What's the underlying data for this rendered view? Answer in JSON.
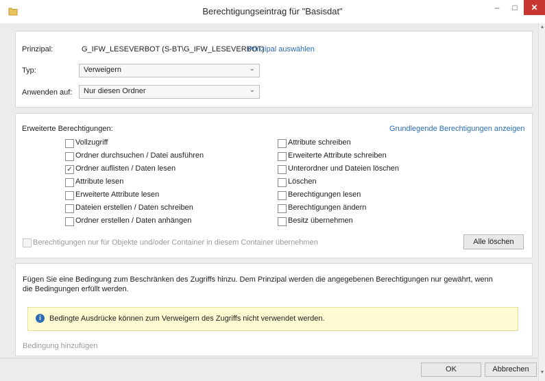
{
  "window": {
    "title": "Berechtigungseintrag für \"Basisdat\"",
    "minimize_glyph": "–",
    "maximize_glyph": "□",
    "close_glyph": "✕"
  },
  "principal": {
    "label": "Prinzipal:",
    "value": "G_IFW_LESEVERBOT (S-BT\\G_IFW_LESEVERBOT)",
    "select_link": "Prinzipal auswählen"
  },
  "type": {
    "label": "Typ:",
    "value": "Verweigern"
  },
  "apply_to": {
    "label": "Anwenden auf:",
    "value": "Nur diesen Ordner"
  },
  "advanced": {
    "header": "Erweiterte Berechtigungen:",
    "basic_link": "Grundlegende Berechtigungen anzeigen",
    "left": [
      {
        "label": "Vollzugriff",
        "checked": false
      },
      {
        "label": "Ordner durchsuchen / Datei ausführen",
        "checked": false
      },
      {
        "label": "Ordner auflisten / Daten lesen",
        "checked": true
      },
      {
        "label": "Attribute lesen",
        "checked": false
      },
      {
        "label": "Erweiterte Attribute lesen",
        "checked": false
      },
      {
        "label": "Dateien erstellen / Daten schreiben",
        "checked": false
      },
      {
        "label": "Ordner erstellen / Daten anhängen",
        "checked": false
      }
    ],
    "right": [
      {
        "label": "Attribute schreiben",
        "checked": false
      },
      {
        "label": "Erweiterte Attribute schreiben",
        "checked": false
      },
      {
        "label": "Unterordner und Dateien löschen",
        "checked": false
      },
      {
        "label": "Löschen",
        "checked": false
      },
      {
        "label": "Berechtigungen lesen",
        "checked": false
      },
      {
        "label": "Berechtigungen ändern",
        "checked": false
      },
      {
        "label": "Besitz übernehmen",
        "checked": false
      }
    ],
    "inherit_label": "Berechtigungen nur für Objekte und/oder Container in diesem Container übernehmen",
    "clear_all": "Alle löschen"
  },
  "condition": {
    "description": "Fügen Sie eine Bedingung zum Beschränken des Zugriffs hinzu. Dem Prinzipal werden die angegebenen Berechtigungen nur gewährt, wenn die Bedingungen erfüllt werden.",
    "info": "Bedingte Ausdrücke können zum Verweigern des Zugriffs nicht verwendet werden.",
    "add_link": "Bedingung hinzufügen"
  },
  "footer": {
    "ok": "OK",
    "cancel": "Abbrechen"
  },
  "colors": {
    "link": "#2a6cb5",
    "close": "#c7372f",
    "info_bg": "#fefbd3"
  }
}
